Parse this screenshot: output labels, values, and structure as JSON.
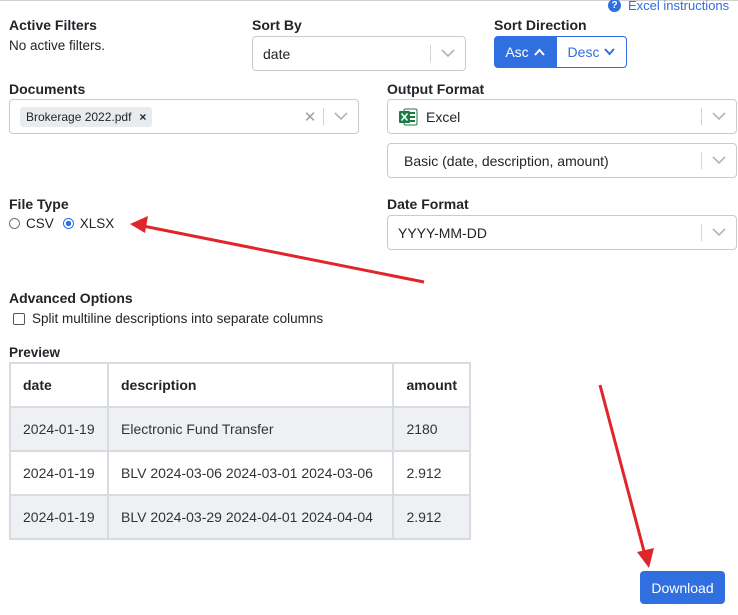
{
  "help_link": {
    "label": "Excel instructions"
  },
  "filters": {
    "title": "Active Filters",
    "status": "No active filters."
  },
  "sort_by": {
    "title": "Sort By",
    "value": "date"
  },
  "sort_direction": {
    "title": "Sort Direction",
    "asc": "Asc",
    "desc": "Desc",
    "selected": "Asc"
  },
  "documents": {
    "title": "Documents",
    "chips": [
      "Brokerage 2022.pdf"
    ]
  },
  "output_format": {
    "title": "Output Format",
    "value": "Excel",
    "template": "Basic (date, description, amount)"
  },
  "file_type": {
    "title": "File Type",
    "options": [
      "CSV",
      "XLSX"
    ],
    "selected": "XLSX"
  },
  "date_format": {
    "title": "Date Format",
    "value": "YYYY-MM-DD"
  },
  "advanced": {
    "title": "Advanced Options",
    "split_multiline_label": "Split multiline descriptions into separate columns",
    "split_multiline_checked": false
  },
  "preview": {
    "title": "Preview",
    "columns": [
      "date",
      "description",
      "amount"
    ],
    "rows": [
      [
        "2024-01-19",
        "Electronic Fund Transfer",
        "2180"
      ],
      [
        "2024-01-19",
        "BLV 2024-03-06 2024-03-01 2024-03-06",
        "2.912"
      ],
      [
        "2024-01-19",
        "BLV 2024-03-29 2024-04-01 2024-04-04",
        "2.912"
      ]
    ]
  },
  "download": {
    "label": "Download"
  },
  "colors": {
    "accent": "#2f6fe0",
    "arrow": "#e0262b"
  }
}
